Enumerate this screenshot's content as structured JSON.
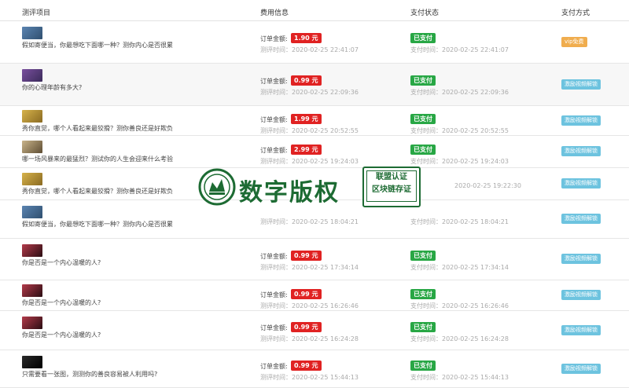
{
  "header": {
    "col_project": "测评项目",
    "col_fee": "费用信息",
    "col_status": "支付状态",
    "col_method": "支付方式"
  },
  "labels": {
    "order_amount": "订单金额:"
  },
  "colors": {
    "price": "#e02222",
    "paid": "#28a745",
    "pay_blue": "#6dc3df",
    "pay_orange": "#f0ad4e",
    "watermark": "#1d6b33"
  },
  "rows": [
    {
      "title": "假如寄便当，你最想吃下面哪一种？测你内心是否很累",
      "price": "1.90 元",
      "eval_time": "测评时间：2020-02-25 22:41:07",
      "status": "已支付",
      "pay_time": "支付时间：2020-02-25 22:41:07",
      "method": "vip免费",
      "thumb_icon": "landscape-thumb-icon"
    },
    {
      "title": "你的心理年龄有多大?",
      "price": "0.99 元",
      "eval_time": "测评时间：2020-02-25 22:09:36",
      "status": "已支付",
      "pay_time": "支付时间：2020-02-25 22:09:36",
      "method": "激励视频解锁",
      "thumb_icon": "mountain-thumb-icon"
    },
    {
      "title": "秀你直觉，哪个人看起来最狡猾？测你善良还是好欺负",
      "price": "1.99 元",
      "eval_time": "测评时间：2020-02-25 20:52:55",
      "status": "已支付",
      "pay_time": "支付时间：2020-02-25 20:52:55",
      "method": "激励视频解锁",
      "thumb_icon": "desert-thumb-icon"
    },
    {
      "title": "哪一场风暴来的最猛烈？测试你的人生会迎来什么考验",
      "price": "2.99 元",
      "eval_time": "测评时间：2020-02-25 19:24:03",
      "status": "已支付",
      "pay_time": "支付时间：2020-02-25 19:24:03",
      "method": "激励视频解锁",
      "thumb_icon": "storm-thumb-icon"
    },
    {
      "title": "秀你直觉，哪个人看起来最狡猾？测你善良还是好欺负",
      "price": "",
      "eval_time": "",
      "status": "",
      "pay_time": "2020-02-25 19:22:30",
      "method": "激励视频解锁",
      "thumb_icon": "desert-thumb-icon"
    },
    {
      "title": "假如寄便当，你最想吃下面哪一种？测你内心是否很累",
      "price": "",
      "eval_time": "测评时间：2020-02-25 18:04:21",
      "status": "",
      "pay_time": "支付时间：2020-02-25 18:04:21",
      "method": "激励视频解锁",
      "thumb_icon": "landscape-thumb-icon"
    },
    {
      "title": "你是否是一个内心温暖的人?",
      "price": "0.99 元",
      "eval_time": "测评时间：2020-02-25 17:34:14",
      "status": "已支付",
      "pay_time": "支付时间：2020-02-25 17:34:14",
      "method": "激励视频解锁",
      "thumb_icon": "heart-thumb-icon"
    },
    {
      "title": "你是否是一个内心温暖的人?",
      "price": "0.99 元",
      "eval_time": "测评时间：2020-02-25 16:26:46",
      "status": "已支付",
      "pay_time": "支付时间：2020-02-25 16:26:46",
      "method": "激励视频解锁",
      "thumb_icon": "heart-thumb-icon"
    },
    {
      "title": "你是否是一个内心温暖的人?",
      "price": "0.99 元",
      "eval_time": "测评时间：2020-02-25 16:24:28",
      "status": "已支付",
      "pay_time": "支付时间：2020-02-25 16:24:28",
      "method": "激励视频解锁",
      "thumb_icon": "heart-thumb-icon"
    },
    {
      "title": "只需要看一张图，测测你的善良容易被人利用吗?",
      "price": "0.99 元",
      "eval_time": "测评时间：2020-02-25 15:44:13",
      "status": "已支付",
      "pay_time": "支付时间：2020-02-25 15:44:13",
      "method": "激励视频解锁",
      "thumb_icon": "dark-thumb-icon"
    }
  ],
  "watermark": {
    "main_text": "数字版权",
    "stamp_line1": "联盟认证",
    "stamp_line2": "区块链存证"
  }
}
